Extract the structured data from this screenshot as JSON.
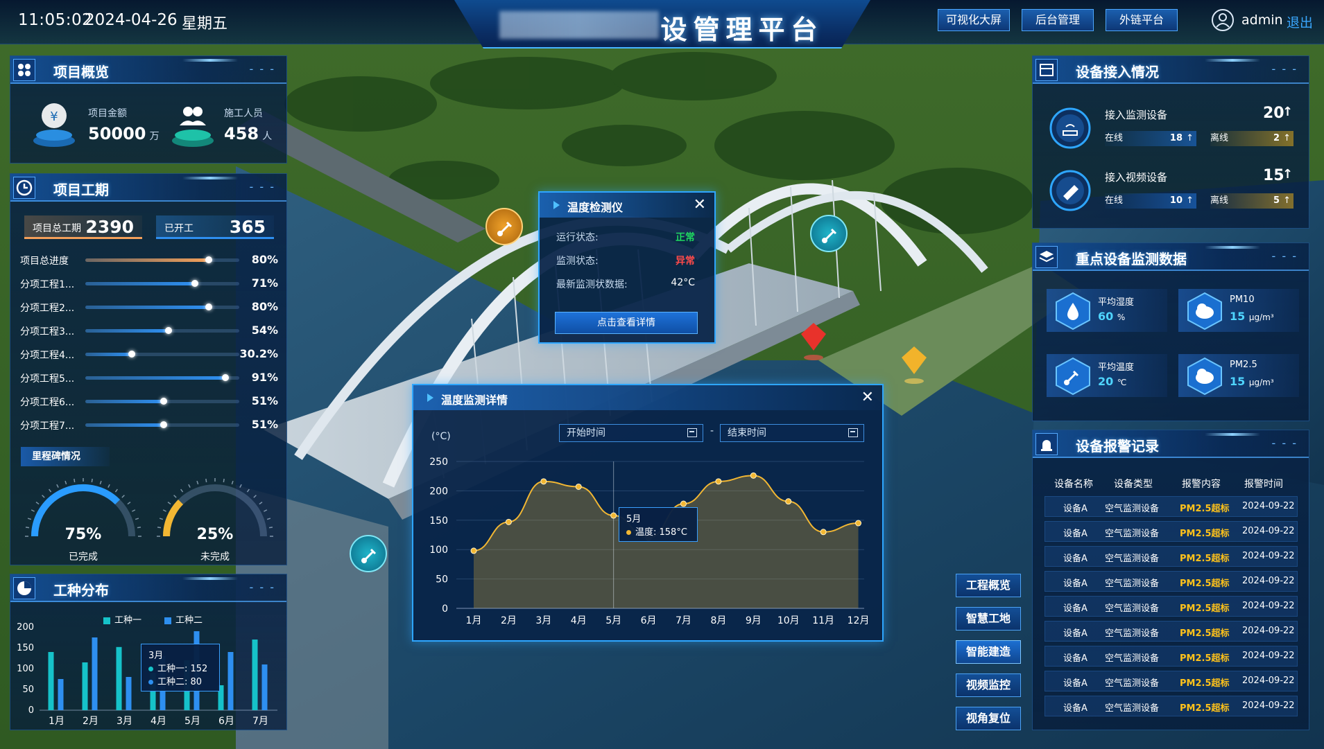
{
  "topbar": {
    "time": "11:05:02",
    "date": "2024-04-26",
    "weekday": "星期五",
    "title": "设管理平台",
    "buttons": [
      "可视化大屏",
      "后台管理",
      "外链平台"
    ],
    "user": "admin",
    "logout": "退出"
  },
  "overview": {
    "title": "项目概览",
    "amount_label": "项目金额",
    "amount_value": "50000",
    "amount_unit": "万",
    "staff_label": "施工人员",
    "staff_value": "458",
    "staff_unit": "人"
  },
  "schedule": {
    "title": "项目工期",
    "total_label": "项目总工期",
    "total_value": "2390",
    "started_label": "已开工",
    "started_value": "365",
    "rows": [
      {
        "label": "项目总进度",
        "value": 0.8,
        "pct": "80%",
        "color": "#f3a05a"
      },
      {
        "label": "分项工程1...",
        "value": 0.71,
        "pct": "71%",
        "color": "#2e8ff0"
      },
      {
        "label": "分项工程2...",
        "value": 0.8,
        "pct": "80%",
        "color": "#2e8ff0"
      },
      {
        "label": "分项工程3...",
        "value": 0.54,
        "pct": "54%",
        "color": "#2e8ff0"
      },
      {
        "label": "分项工程4...",
        "value": 0.302,
        "pct": "30.2%",
        "color": "#2e8ff0"
      },
      {
        "label": "分项工程5...",
        "value": 0.91,
        "pct": "91%",
        "color": "#2e8ff0"
      },
      {
        "label": "分项工程6...",
        "value": 0.51,
        "pct": "51%",
        "color": "#2e8ff0"
      },
      {
        "label": "分项工程7...",
        "value": 0.51,
        "pct": "51%",
        "color": "#2e8ff0"
      }
    ],
    "milestone_label": "里程碑情况",
    "gauges": [
      {
        "value": 0.75,
        "text": "75%",
        "label": "已完成",
        "color": "#2a9cff"
      },
      {
        "value": 0.25,
        "text": "25%",
        "label": "未完成",
        "color": "#f2b733"
      }
    ]
  },
  "worktype": {
    "title": "工种分布",
    "legend": [
      "工种一",
      "工种二"
    ],
    "colors": [
      "#16c2c9",
      "#2e8ff0"
    ],
    "tooltip": {
      "title": "3月",
      "line1": "工种一: 152",
      "line2": "工种二: 80"
    }
  },
  "chart_data": [
    {
      "type": "bar",
      "categories": [
        "1月",
        "2月",
        "3月",
        "4月",
        "5月",
        "6月",
        "7月"
      ],
      "ylim": [
        0,
        200
      ],
      "yticks": [
        "0",
        "50",
        "100",
        "150",
        "200"
      ],
      "series": [
        {
          "name": "工种一",
          "values": [
            140,
            115,
            152,
            90,
            120,
            60,
            170
          ]
        },
        {
          "name": "工种二",
          "values": [
            75,
            175,
            80,
            130,
            190,
            140,
            110
          ]
        }
      ]
    },
    {
      "type": "line",
      "ylabel": "(°C)",
      "categories": [
        "1月",
        "2月",
        "3月",
        "4月",
        "5月",
        "6月",
        "7月",
        "8月",
        "9月",
        "10月",
        "11月",
        "12月"
      ],
      "ylim": [
        0,
        250
      ],
      "yticks": [
        "0",
        "50",
        "100",
        "150",
        "200",
        "250"
      ],
      "series": [
        {
          "name": "温度",
          "values": [
            98,
            147,
            216,
            207,
            158,
            120,
            178,
            216,
            226,
            182,
            130,
            145
          ]
        }
      ]
    }
  ],
  "devices": {
    "title": "设备接入情况",
    "monitor_label": "接入监测设备",
    "monitor_total": "20",
    "monitor_online": "18",
    "monitor_offline": "2",
    "video_label": "接入视频设备",
    "video_total": "15",
    "video_online": "10",
    "video_offline": "5",
    "online_label": "在线",
    "offline_label": "离线"
  },
  "key_data": {
    "title": "重点设备监测数据",
    "items": [
      {
        "label": "平均湿度",
        "value": "60",
        "unit": "%"
      },
      {
        "label": "PM10",
        "value": "15",
        "unit": "μg/m³"
      },
      {
        "label": "平均温度",
        "value": "20",
        "unit": "℃"
      },
      {
        "label": "PM2.5",
        "value": "15",
        "unit": "μg/m³"
      }
    ]
  },
  "alarms": {
    "title": "设备报警记录",
    "headers": [
      "设备名称",
      "设备类型",
      "报警内容",
      "报警时间"
    ],
    "rows": [
      [
        "设备A",
        "空气监测设备",
        "PM2.5超标",
        "2024-09-22"
      ],
      [
        "设备A",
        "空气监测设备",
        "PM2.5超标",
        "2024-09-22"
      ],
      [
        "设备A",
        "空气监测设备",
        "PM2.5超标",
        "2024-09-22"
      ],
      [
        "设备A",
        "空气监测设备",
        "PM2.5超标",
        "2024-09-22"
      ],
      [
        "设备A",
        "空气监测设备",
        "PM2.5超标",
        "2024-09-22"
      ],
      [
        "设备A",
        "空气监测设备",
        "PM2.5超标",
        "2024-09-22"
      ],
      [
        "设备A",
        "空气监测设备",
        "PM2.5超标",
        "2024-09-22"
      ],
      [
        "设备A",
        "空气监测设备",
        "PM2.5超标",
        "2024-09-22"
      ],
      [
        "设备A",
        "空气监测设备",
        "PM2.5超标",
        "2024-09-22"
      ]
    ]
  },
  "side_nav": [
    "工程概览",
    "智慧工地",
    "智能建造",
    "视频监控",
    "视角复位"
  ],
  "temp_popup": {
    "title": "温度检测仪",
    "run_label": "运行状态:",
    "run_value": "正常",
    "mon_label": "监测状态:",
    "mon_value": "异常",
    "latest_label": "最新监测状数据:",
    "latest_value": "42°C",
    "button": "点击查看详情",
    "colors": {
      "ok": "#1ed760",
      "bad": "#ff4a4a"
    }
  },
  "detail_popup": {
    "title": "温度监测详情",
    "start_placeholder": "开始时间",
    "end_placeholder": "结束时间",
    "separator": "-",
    "tooltip_title": "5月",
    "tooltip_line": "温度: 158°C"
  }
}
